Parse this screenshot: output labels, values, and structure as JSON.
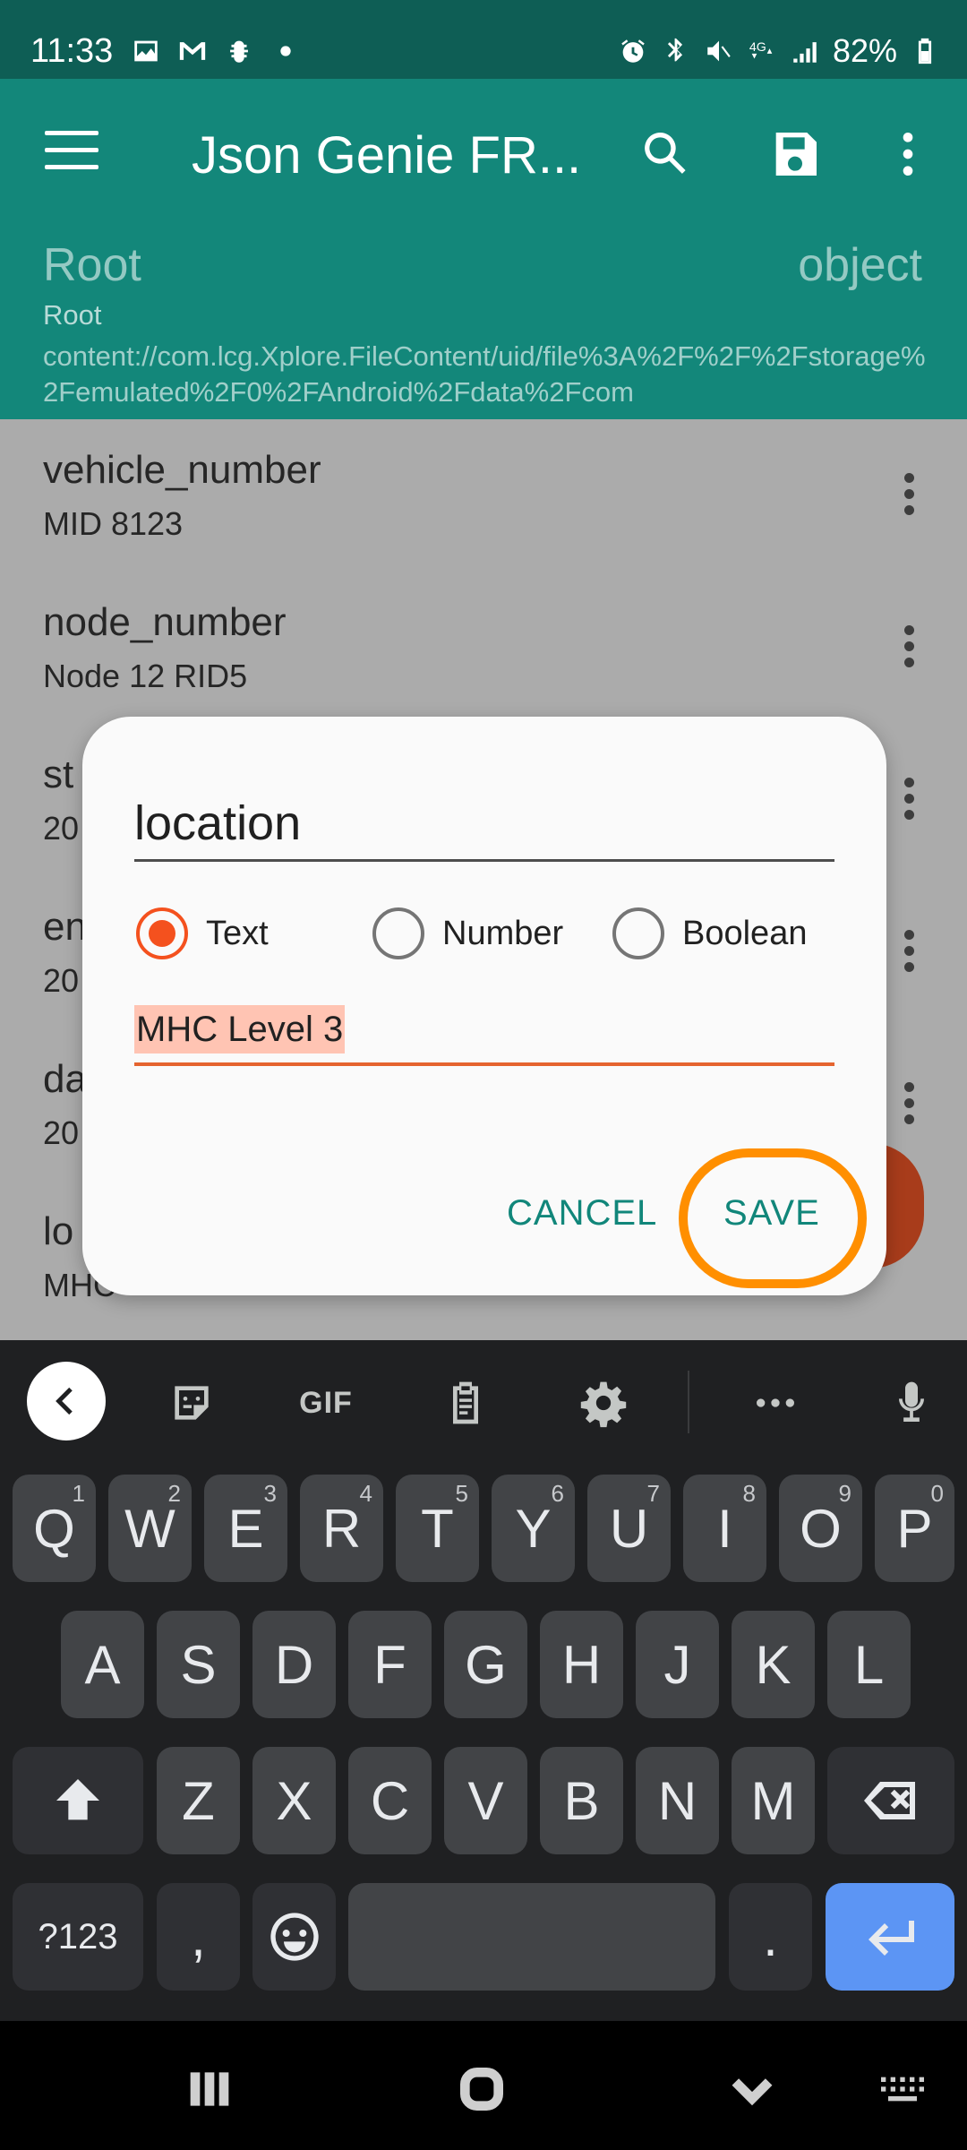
{
  "status_bar": {
    "time": "11:33",
    "battery": "82%",
    "network": "4G"
  },
  "app_bar": {
    "title": "Json Genie FR...",
    "root_title": "Root",
    "root_type": "object",
    "root_sub": "Root",
    "root_path": "content://com.lcg.Xplore.FileContent/uid/file%3A%2F%2F%2Fstorage%2Femulated%2F0%2FAndroid%2Fdata%2Fcom"
  },
  "list": {
    "items": [
      {
        "key": "vehicle_number",
        "value": "MID 8123"
      },
      {
        "key": "node_number",
        "value": "Node 12 RID5"
      },
      {
        "key": "st",
        "value": "20"
      },
      {
        "key": "en",
        "value": "20"
      },
      {
        "key": "da",
        "value": "20"
      },
      {
        "key": "lo",
        "value": "MHC"
      }
    ]
  },
  "dialog": {
    "name_value": "location",
    "types": [
      {
        "label": "Text",
        "checked": true
      },
      {
        "label": "Number",
        "checked": false
      },
      {
        "label": "Boolean",
        "checked": false
      }
    ],
    "value": "MHC Level 3",
    "cancel_label": "CANCEL",
    "save_label": "SAVE"
  },
  "keyboard": {
    "toolbar": {
      "gif_label": "GIF"
    },
    "row1": [
      {
        "k": "Q",
        "h": "1"
      },
      {
        "k": "W",
        "h": "2"
      },
      {
        "k": "E",
        "h": "3"
      },
      {
        "k": "R",
        "h": "4"
      },
      {
        "k": "T",
        "h": "5"
      },
      {
        "k": "Y",
        "h": "6"
      },
      {
        "k": "U",
        "h": "7"
      },
      {
        "k": "I",
        "h": "8"
      },
      {
        "k": "O",
        "h": "9"
      },
      {
        "k": "P",
        "h": "0"
      }
    ],
    "row2": [
      "A",
      "S",
      "D",
      "F",
      "G",
      "H",
      "J",
      "K",
      "L"
    ],
    "row3": [
      "Z",
      "X",
      "C",
      "V",
      "B",
      "N",
      "M"
    ],
    "symbols_label": "?123",
    "comma_label": ",",
    "period_label": "."
  },
  "colors": {
    "status_bar": "#0e5e55",
    "app_bar": "#13877a",
    "accent": "#f4511e",
    "dialog_button": "#11867a",
    "highlight": "#ff8f00",
    "enter_key": "#5c95f4"
  }
}
